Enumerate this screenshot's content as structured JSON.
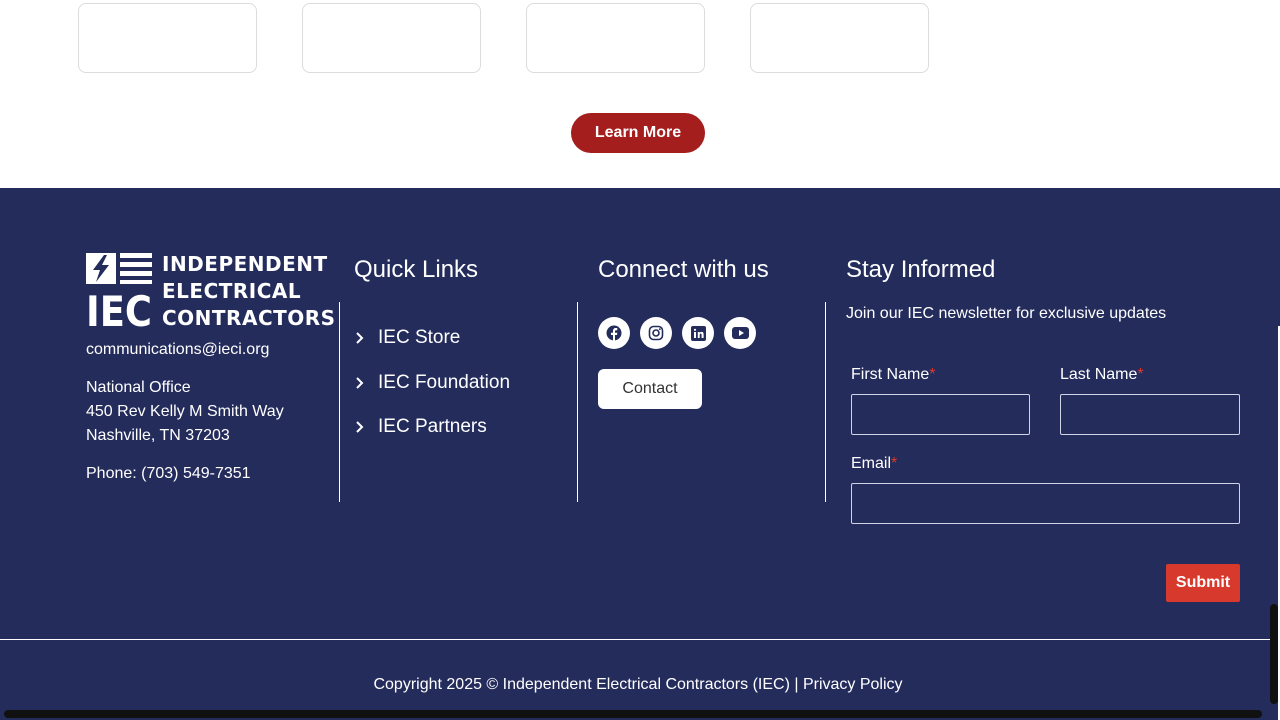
{
  "top": {
    "learn_more_label": "Learn More"
  },
  "logo": {
    "line1": "INDEPENDENT",
    "line2": "ELECTRICAL",
    "line3": "CONTRACTORS",
    "mark_text": "IEC"
  },
  "contact": {
    "email": "communications@ieci.org",
    "office_label": "National Office",
    "street": "450 Rev Kelly M Smith Way",
    "city": "Nashville, TN 37203",
    "phone": "Phone: (703) 549-7351"
  },
  "quick_links": {
    "title": "Quick Links",
    "items": [
      {
        "label": "IEC Store"
      },
      {
        "label": "IEC Foundation"
      },
      {
        "label": "IEC Partners"
      }
    ]
  },
  "connect": {
    "title": "Connect with us",
    "icons": [
      "facebook-icon",
      "instagram-icon",
      "linkedin-icon",
      "youtube-icon"
    ],
    "contact_label": "Contact"
  },
  "newsletter": {
    "title": "Stay Informed",
    "text": "Join our IEC newsletter for exclusive updates",
    "first_name_label": "First Name",
    "last_name_label": "Last Name",
    "email_label": "Email",
    "required_mark": "*",
    "submit_label": "Submit"
  },
  "bottom": {
    "copyright": "Copyright 2025 © Independent Electrical Contractors (IEC) | ",
    "privacy_label": "Privacy Policy"
  },
  "colors": {
    "footer_bg": "#242c5c",
    "accent_red": "#a51e1e",
    "submit_red": "#d8392d"
  }
}
